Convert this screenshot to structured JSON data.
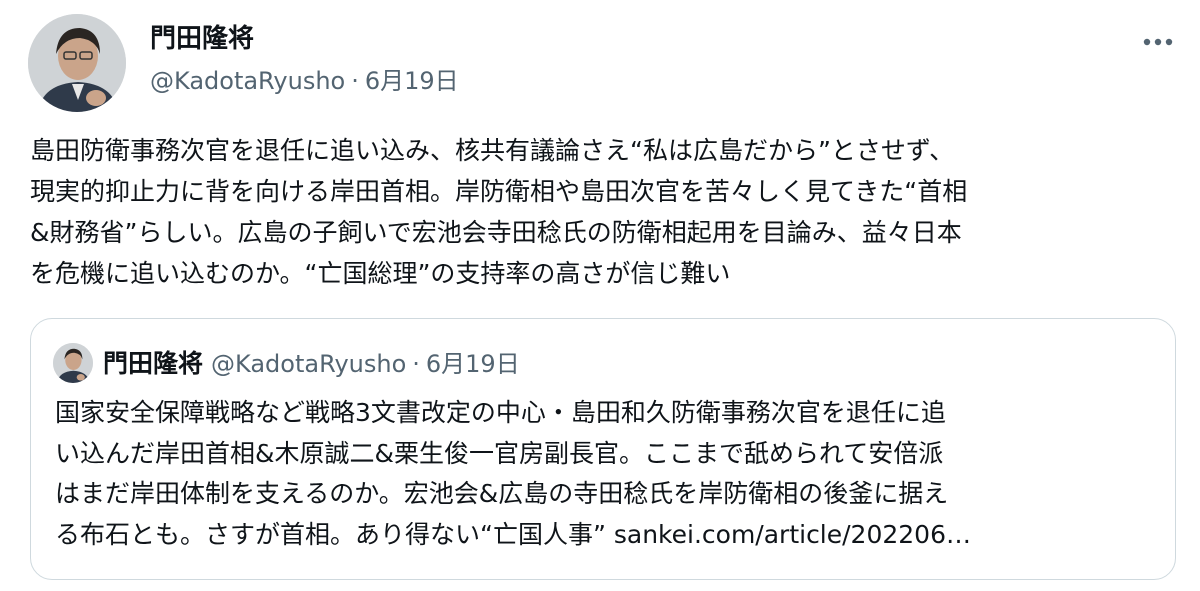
{
  "tweet": {
    "author_name": "門田隆将",
    "handle": "@KadotaRyusho",
    "separator": "·",
    "date": "6月19日",
    "text": "島田防衛事務次官を退任に追い込み、核共有議論さえ“私は広島だから”とさせず、\n現実的抑止力に背を向ける岸田首相。岸防衛相や島田次官を苦々しく見てきた“首相\n&財務省”らしい。広島の子飼いで宏池会寺田稔氏の防衛相起用を目論み、益々日本\nを危機に追い込むのか。“亡国総理”の支持率の高さが信じ難い",
    "more_icon": "more-horizontal-icon"
  },
  "quote": {
    "author_name": "門田隆将",
    "handle": "@KadotaRyusho",
    "separator": "·",
    "date": "6月19日",
    "text": "国家安全保障戦略など戦略3文書改定の中心・島田和久防衛事務次官を退任に追\nい込んだ岸田首相&木原誠二&栗生俊一官房副長官。ここまで舐められて安倍派\nはまだ岸田体制を支えるのか。宏池会&広島の寺田稔氏を岸防衛相の後釜に据え\nる布石とも。さすが首相。あり得ない“亡国人事” sankei.com/article/202206…"
  },
  "colors": {
    "text_primary": "#0f1419",
    "text_secondary": "#536471",
    "border": "#cfd9de",
    "background": "#ffffff"
  }
}
